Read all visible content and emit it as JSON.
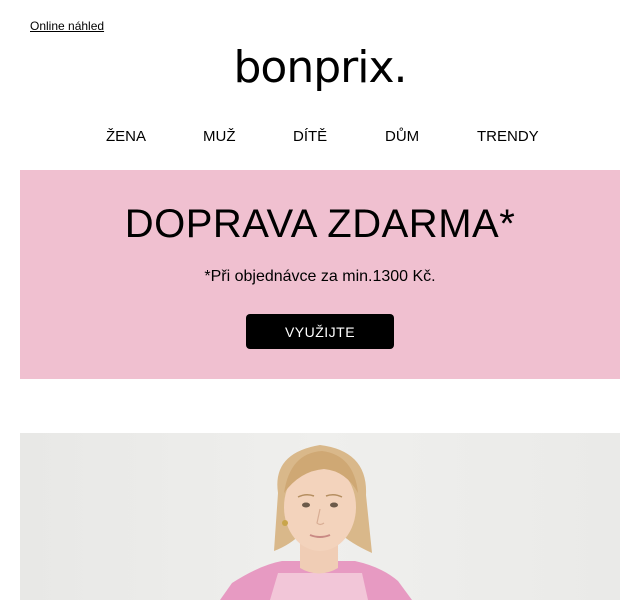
{
  "header": {
    "online_link": "Online náhled",
    "logo_text": "bonprix",
    "logo_dot": "."
  },
  "nav": {
    "items": [
      "ŽENA",
      "MUŽ",
      "DÍTĚ",
      "DŮM",
      "TRENDY"
    ]
  },
  "promo": {
    "title": "DOPRAVA ZDARMA*",
    "subtitle": "*Při objednávce za min.1300 Kč.",
    "button_label": "VYUŽIJTE",
    "background_color": "#f0c0d0"
  },
  "hero": {
    "image": "woman-in-pink-knit-cardigan"
  }
}
